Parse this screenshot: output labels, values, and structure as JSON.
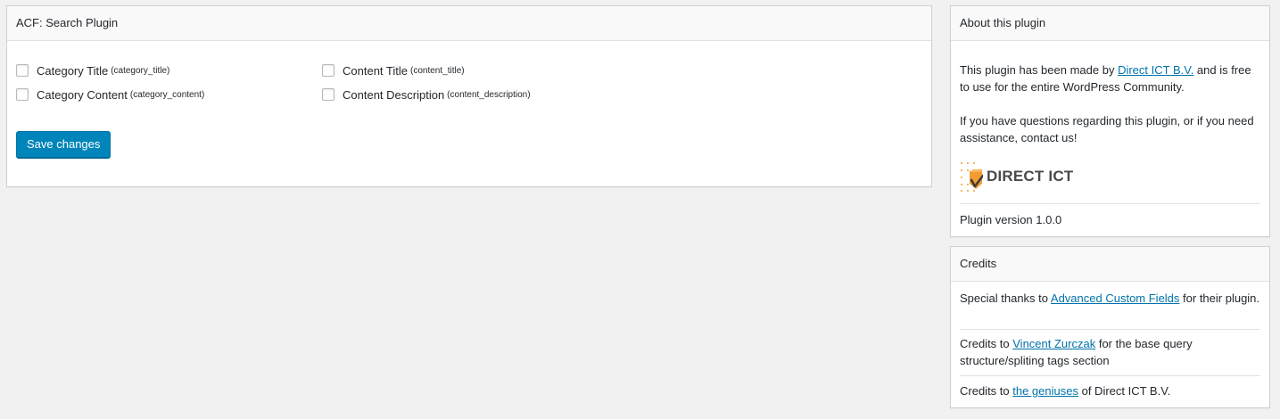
{
  "main": {
    "title": "ACF: Search Plugin",
    "options": [
      {
        "label": "Category Title",
        "key": "(category_title)",
        "checked": false
      },
      {
        "label": "Category Content",
        "key": "(category_content)",
        "checked": false
      },
      {
        "label": "Content Title",
        "key": "(content_title)",
        "checked": false
      },
      {
        "label": "Content Description",
        "key": "(content_description)",
        "checked": false
      }
    ],
    "save_label": "Save changes"
  },
  "about": {
    "title": "About this plugin",
    "p1_before": "This plugin has been made by ",
    "p1_link": "Direct ICT B.V.",
    "p1_after": " and is free to use for the entire WordPress Community.",
    "p2": "If you have questions regarding this plugin, or if you need assistance, contact us!",
    "logo_text": "DIRECT ICT",
    "version": "Plugin version 1.0.0"
  },
  "credits": {
    "title": "Credits",
    "c1_before": "Special thanks to ",
    "c1_link": "Advanced Custom Fields",
    "c1_after": " for their plugin.",
    "c2_before": "Credits to ",
    "c2_link": "Vincent Zurczak",
    "c2_after": " for the base query structure/spliting tags section",
    "c3_before": "Credits to ",
    "c3_link": "the geniuses",
    "c3_after": " of Direct ICT B.V."
  },
  "colors": {
    "accent": "#0085ba",
    "link": "#0073aa",
    "logo_orange": "#f39c32"
  }
}
